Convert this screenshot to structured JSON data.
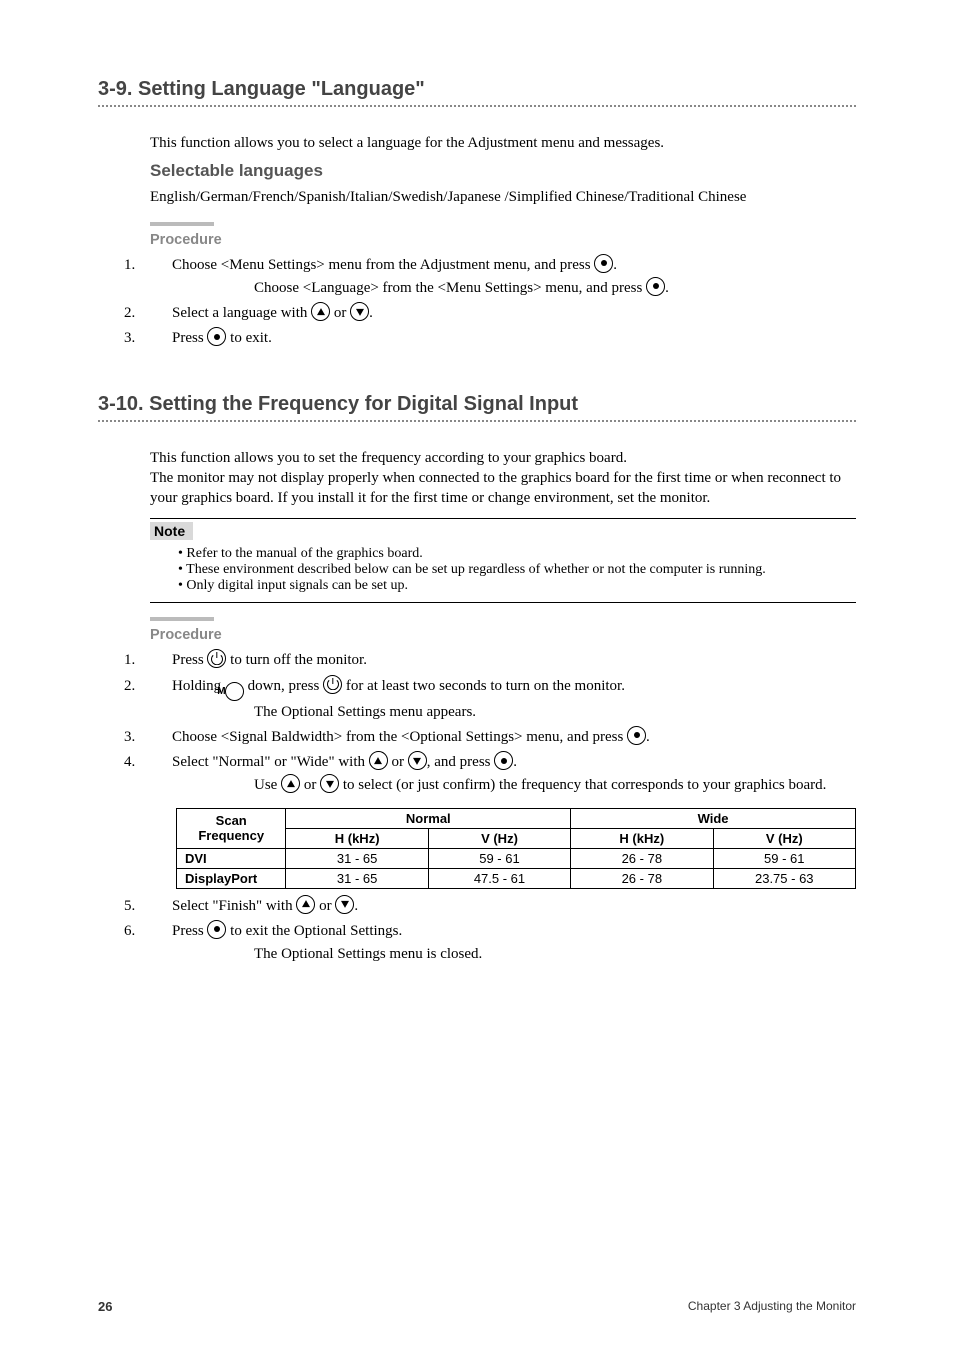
{
  "section1": {
    "heading": "3-9. Setting Language \"Language\"",
    "intro": "This function allows you to select a language for the Adjustment menu and messages.",
    "sel_heading": "Selectable languages",
    "sel_text": "English/German/French/Spanish/Italian/Swedish/Japanese /Simplified Chinese/Traditional Chinese",
    "proc_heading": "Procedure",
    "step1a": "Choose <Menu Settings> menu from the Adjustment menu, and press ",
    "step1b": "Choose <Language> from the <Menu Settings> menu, and press ",
    "step2a": "Select a language with ",
    "step2_or": " or ",
    "step3a": "Press ",
    "step3b": " to exit."
  },
  "section2": {
    "heading": "3-10. Setting the Frequency for Digital Signal Input",
    "intro1": "This function allows you to set the frequency according to your graphics board.",
    "intro2": "The monitor may not display properly when connected to the graphics board for the first time or when reconnect to your graphics board. If you install it for the first time or change environment, set the monitor.",
    "note_head": "Note",
    "note1": "• Refer to the manual of the graphics board.",
    "note2": "• These environment described below can be set up regardless of whether or not the computer is running.",
    "note3": "• Only digital input signals can be set up.",
    "proc_heading": "Procedure",
    "s1a": "Press ",
    "s1b": " to turn off the monitor.",
    "s2a": "Holding ",
    "s2b": " down, press ",
    "s2c": " for at least two seconds to turn on the monitor.",
    "s2d": "The Optional Settings menu appears.",
    "s3a": "Choose <Signal Baldwidth> from the <Optional Settings> menu, and press ",
    "s4a": "Select \"Normal\" or \"Wide\" with ",
    "s4or": " or ",
    "s4b": ", and press ",
    "s4c": "Use ",
    "s4d": " or ",
    "s4e": " to select (or just confirm) the frequency that corresponds to your graphics board.",
    "s5a": "Select \"Finish\" with ",
    "s5or": " or ",
    "s6a": "Press ",
    "s6b": " to exit the Optional Settings.",
    "s6c": "The Optional Settings menu is closed."
  },
  "chart_data": {
    "type": "table",
    "title": "Scan Frequency",
    "column_groups": [
      "Normal",
      "Wide"
    ],
    "sub_columns": [
      "H (kHz)",
      "V (Hz)",
      "H (kHz)",
      "V (Hz)"
    ],
    "rows": [
      {
        "label": "DVI",
        "values": [
          "31 - 65",
          "59 - 61",
          "26 - 78",
          "59 - 61"
        ]
      },
      {
        "label": "DisplayPort",
        "values": [
          "31 - 65",
          "47.5 - 61",
          "26 - 78",
          "23.75 - 63"
        ]
      }
    ]
  },
  "footer": {
    "page": "26",
    "chapter": "Chapter 3 Adjusting the Monitor"
  }
}
